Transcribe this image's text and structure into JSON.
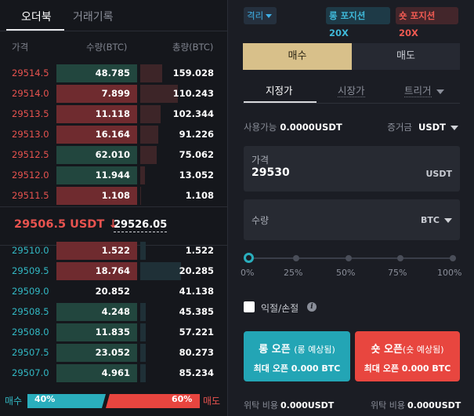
{
  "orderbook": {
    "tabs": [
      {
        "label": "오더북",
        "active": true
      },
      {
        "label": "거래기록",
        "active": false
      }
    ],
    "headers": {
      "price": "가격",
      "quantity": "수량(BTC)",
      "total": "총량(BTC)"
    },
    "asks": [
      {
        "price": "29514.5",
        "qty": "48.785",
        "total": "159.028",
        "depth_ratio": 0.5
      },
      {
        "price": "29514.0",
        "qty": "7.899",
        "total": "110.243",
        "depth_ratio": 0.85
      },
      {
        "price": "29513.5",
        "qty": "11.118",
        "total": "102.344",
        "depth_ratio": 0.47
      },
      {
        "price": "29513.0",
        "qty": "16.164",
        "total": "91.226",
        "depth_ratio": 0.41
      },
      {
        "price": "29512.5",
        "qty": "62.010",
        "total": "75.062",
        "depth_ratio": 0.38
      },
      {
        "price": "29512.0",
        "qty": "11.944",
        "total": "13.052",
        "depth_ratio": 0.1
      },
      {
        "price": "29511.5",
        "qty": "1.108",
        "total": "1.108",
        "depth_ratio": 0.02
      }
    ],
    "mid": {
      "last_price": "29506.5 USDT ↓",
      "mark_price": "29526.05"
    },
    "bids": [
      {
        "price": "29510.0",
        "qty": "1.522",
        "total": "1.522",
        "depth_ratio": 0.12
      },
      {
        "price": "29509.5",
        "qty": "18.764",
        "total": "20.285",
        "depth_ratio": 0.92
      },
      {
        "price": "29509.0",
        "qty": "20.852",
        "total": "41.138",
        "depth_ratio": 0.0
      },
      {
        "price": "29508.5",
        "qty": "4.248",
        "total": "45.385",
        "depth_ratio": 0.12
      },
      {
        "price": "29508.0",
        "qty": "11.835",
        "total": "57.221",
        "depth_ratio": 0.12
      },
      {
        "price": "29507.5",
        "qty": "23.052",
        "total": "80.273",
        "depth_ratio": 0.12
      },
      {
        "price": "29507.0",
        "qty": "4.961",
        "total": "85.234",
        "depth_ratio": 0.12
      }
    ],
    "ratio": {
      "buy_label": "매수",
      "sell_label": "매도",
      "buy_pct": "40%",
      "sell_pct": "60%",
      "buy_fraction": 0.4
    }
  },
  "order_panel": {
    "margin_mode": "격리",
    "long_leverage": "롱 포지션 20X",
    "short_leverage": "숏 포지션 20X",
    "side_tabs": {
      "buy": "매수",
      "sell": "매도"
    },
    "order_types": [
      {
        "label": "지정가",
        "active": true
      },
      {
        "label": "시장가",
        "active": false
      },
      {
        "label": "트리거",
        "active": false
      }
    ],
    "available_label": "사용가능",
    "available_value": "0.0000USDT",
    "margin_label": "증거금",
    "margin_currency": "USDT",
    "price_field": {
      "label": "가격",
      "value": "29530",
      "unit": "USDT"
    },
    "qty_field": {
      "label": "수량",
      "unit": "BTC"
    },
    "slider": {
      "labels": [
        "0%",
        "25%",
        "50%",
        "75%",
        "100%"
      ],
      "value": 0
    },
    "tpsl": {
      "label": "익절/손절",
      "checked": false
    },
    "open_long": {
      "title": "롱 오픈",
      "hint": "(롱 예상됨)",
      "max_label": "최대 오픈",
      "max_value": "0.000 BTC"
    },
    "open_short": {
      "title": "숏 오픈",
      "hint": "(숏 예상됨)",
      "max_label": "최대 오픈",
      "max_value": "0.000 BTC"
    },
    "fee_long": {
      "label": "위탁 비용",
      "value": "0.000USDT"
    },
    "fee_short": {
      "label": "위탁 비용",
      "value": "0.000USDT"
    }
  }
}
